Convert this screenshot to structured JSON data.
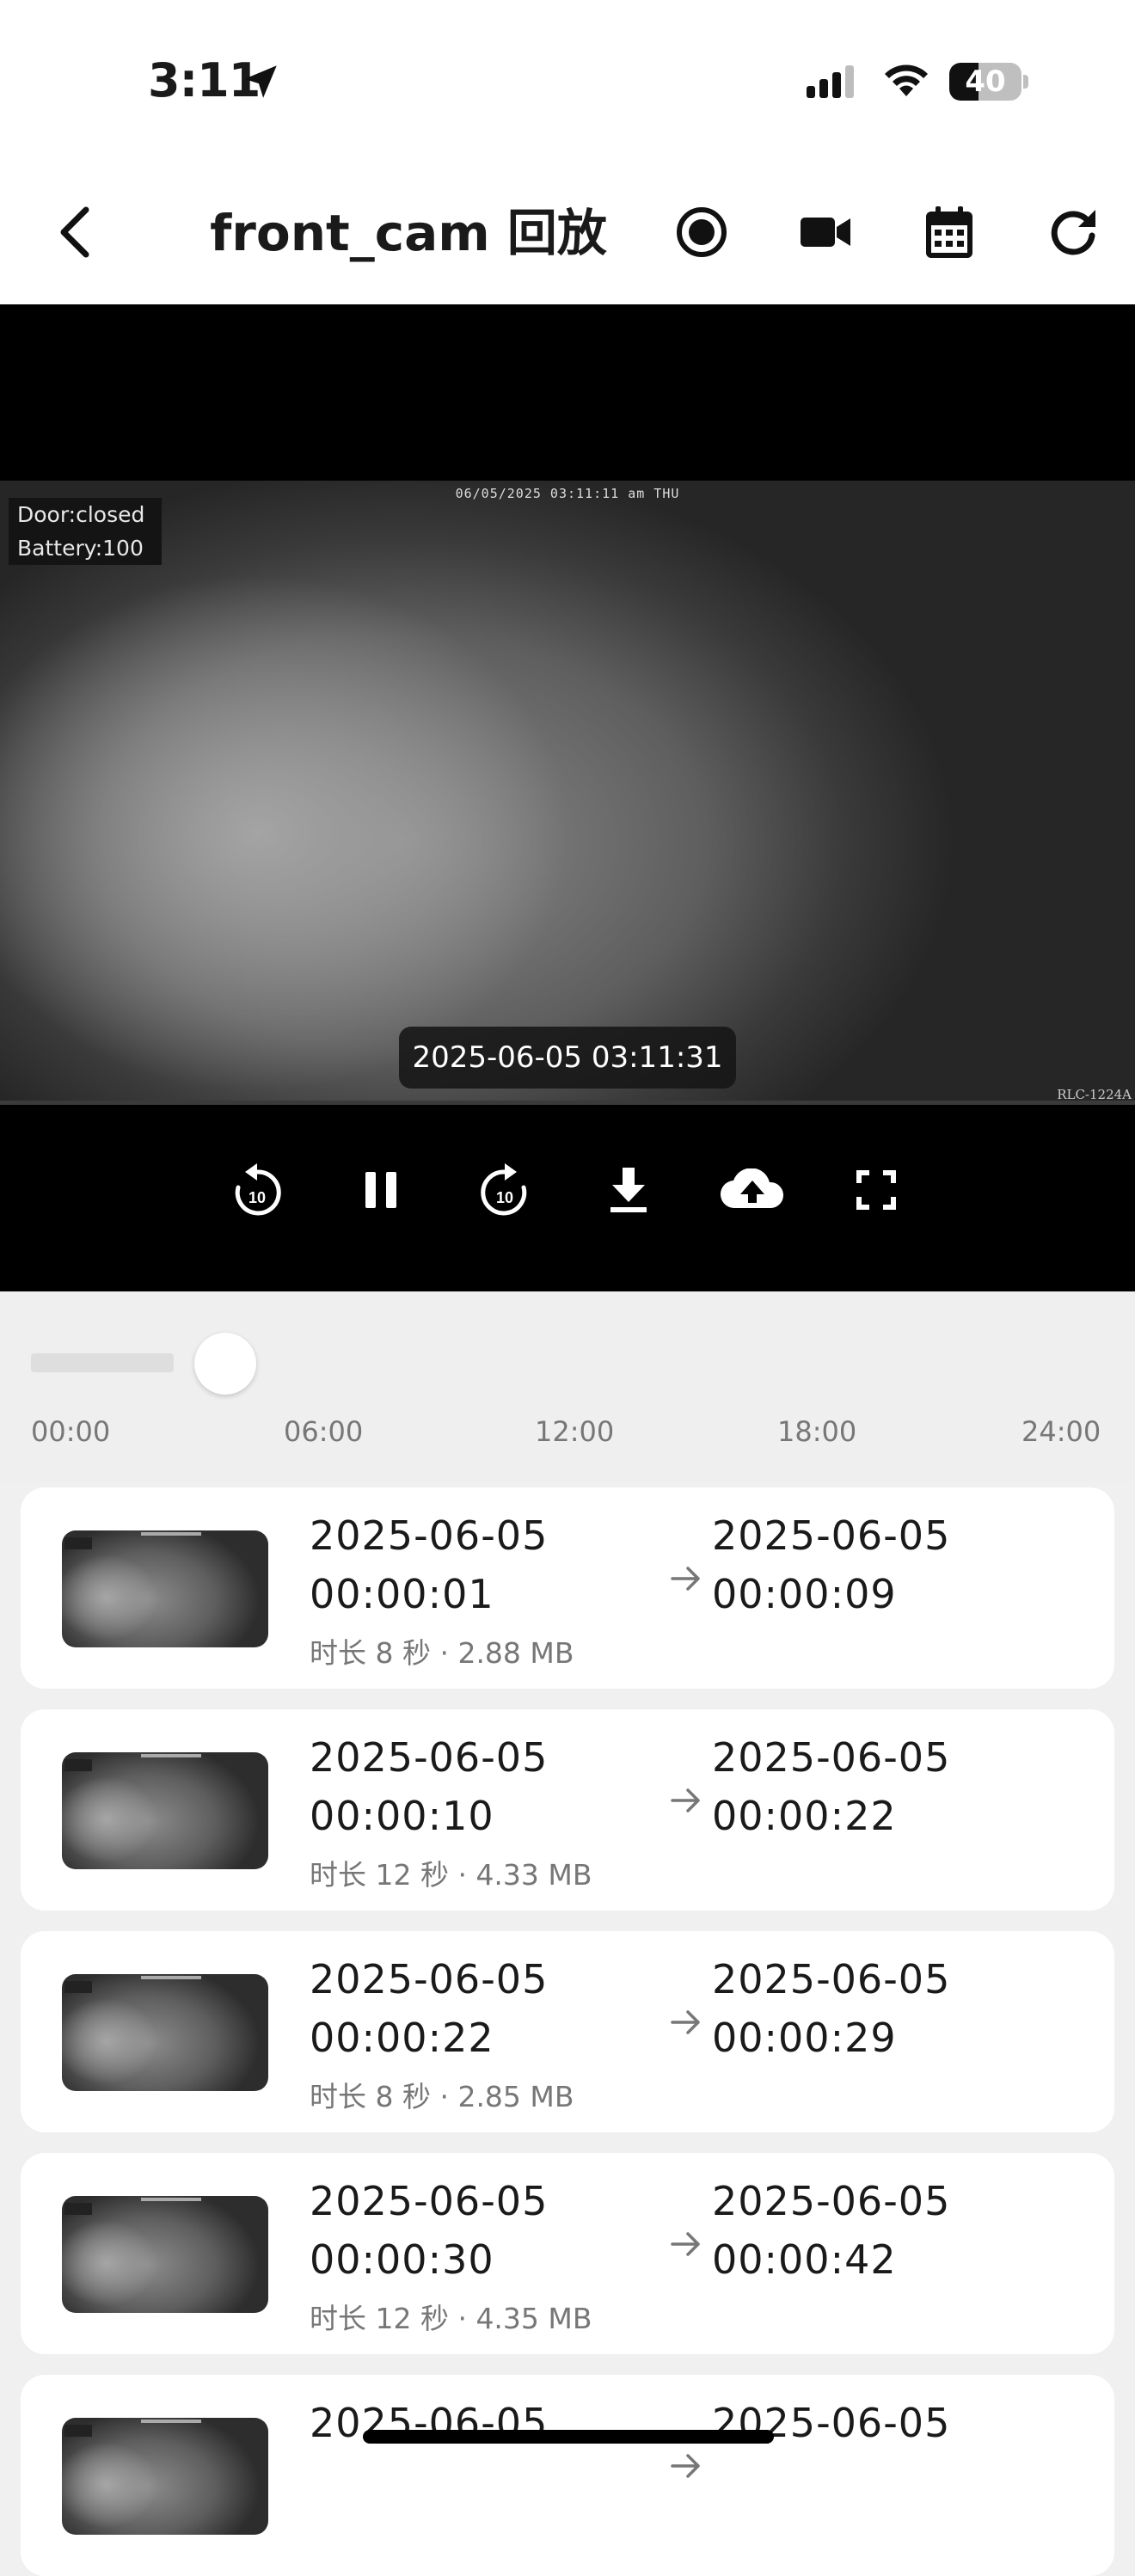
{
  "status_bar": {
    "time": "3:11",
    "battery": "40",
    "battery_level": 0.4,
    "location_icon": "location-arrow-icon",
    "signal_icon": "cellular-signal-icon",
    "wifi_icon": "wifi-icon"
  },
  "app_bar": {
    "back_icon": "chevron-left-icon",
    "title": "front_cam 回放",
    "actions": [
      "record-icon",
      "video-camera-icon",
      "calendar-icon",
      "refresh-icon"
    ]
  },
  "player": {
    "overlay_lines": [
      "Door:closed",
      "Battery:100"
    ],
    "osd_timestamp": "06/05/2025 03:11:11 am THU",
    "camera_model": "RLC-1224A",
    "current_time": "2025-06-05 03:11:31",
    "controls": [
      "replay-10-icon",
      "pause-icon",
      "forward-10-icon",
      "download-icon",
      "cloud-upload-icon",
      "fullscreen-icon"
    ],
    "playback_progress": 0.0
  },
  "timeline": {
    "ticks": [
      "00:00",
      "06:00",
      "12:00",
      "18:00",
      "24:00"
    ]
  },
  "recordings": [
    {
      "start_date": "2025-06-05",
      "start_time": "00:00:01",
      "end_date": "2025-06-05",
      "end_time": "00:00:09",
      "meta": "时长 8 秒 · 2.88 MB"
    },
    {
      "start_date": "2025-06-05",
      "start_time": "00:00:10",
      "end_date": "2025-06-05",
      "end_time": "00:00:22",
      "meta": "时长 12 秒 · 4.33 MB"
    },
    {
      "start_date": "2025-06-05",
      "start_time": "00:00:22",
      "end_date": "2025-06-05",
      "end_time": "00:00:29",
      "meta": "时长 8 秒 · 2.85 MB"
    },
    {
      "start_date": "2025-06-05",
      "start_time": "00:00:30",
      "end_date": "2025-06-05",
      "end_time": "00:00:42",
      "meta": "时长 12 秒 · 4.35 MB"
    },
    {
      "start_date": "2025-06-05",
      "start_time": "",
      "end_date": "2025-06-05",
      "end_time": "",
      "meta": ""
    }
  ]
}
